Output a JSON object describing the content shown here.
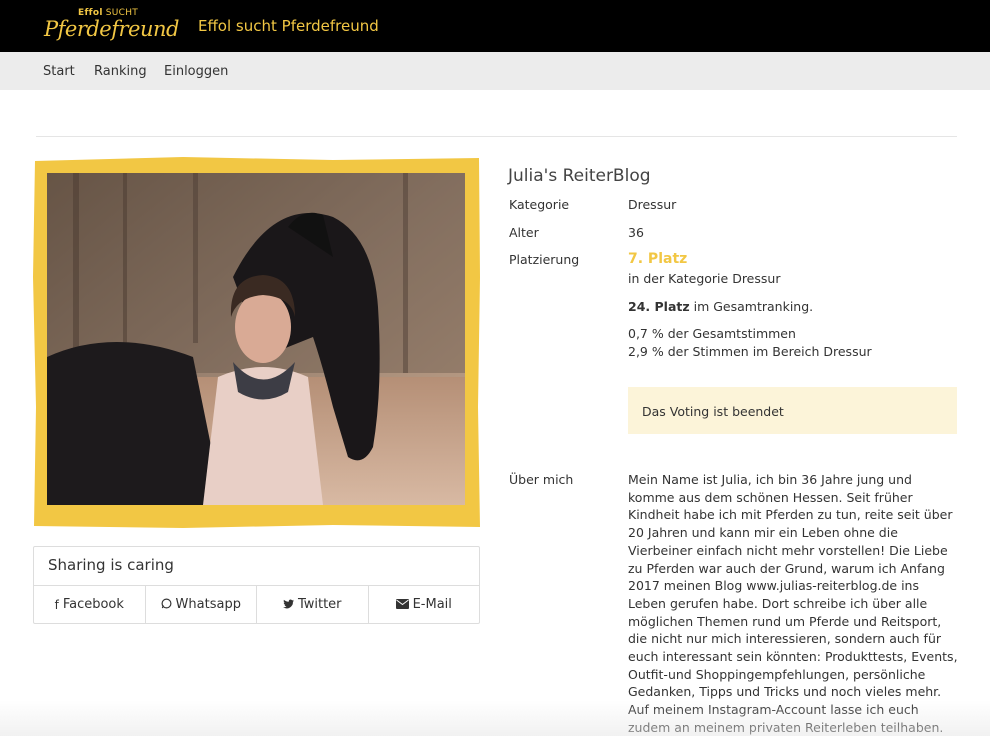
{
  "header": {
    "logo_small": "Effol",
    "logo_small_suffix": "SUCHT",
    "logo_big": "Pferdefreund",
    "site_title": "Effol sucht Pferdefreund",
    "accent_color": "#f2c744"
  },
  "nav": {
    "items": [
      {
        "label": "Start"
      },
      {
        "label": "Ranking"
      },
      {
        "label": "Einloggen"
      }
    ]
  },
  "sharing": {
    "title": "Sharing is caring",
    "buttons": [
      {
        "label": "Facebook",
        "icon": "facebook-icon"
      },
      {
        "label": "Whatsapp",
        "icon": "whatsapp-icon"
      },
      {
        "label": "Twitter",
        "icon": "twitter-icon"
      },
      {
        "label": "E-Mail",
        "icon": "envelope-icon"
      }
    ]
  },
  "profile": {
    "blog_name": "Julia's ReiterBlog",
    "category_label": "Kategorie",
    "category_value": "Dressur",
    "age_label": "Alter",
    "age_value": "36",
    "placement_label": "Platzierung",
    "rank": "7. Platz",
    "rank_sub": "in der Kategorie Dressur",
    "total_rank_num": "24. Platz",
    "total_rank_text": "im Gesamtranking.",
    "pct_total": "0,7 % der Gesamtstimmen",
    "pct_category": "2,9 % der Stimmen im Bereich Dressur",
    "vote_status": "Das Voting ist beendet",
    "about_label": "Über mich",
    "about_text": "Mein Name ist Julia, ich bin 36 Jahre jung und komme aus dem schönen Hessen. Seit früher Kindheit habe ich mit Pferden zu tun, reite seit über 20 Jahren und kann mir ein Leben ohne die Vierbeiner einfach nicht mehr vorstellen! Die Liebe zu Pferden war auch der Grund, warum ich Anfang 2017 meinen Blog www.julias-reiterblog.de ins Leben gerufen habe. Dort schreibe ich über alle möglichen Themen rund um Pferde und Reitsport, die nicht nur mich interessieren, sondern auch für euch interessant sein könnten: Produkttests, Events, Outfit-und Shoppingempfehlungen, persönliche Gedanken, Tipps und Tricks und noch vieles mehr. Auf meinem Instagram-Account lasse ich euch zudem an meinem privaten Reiterleben teilhaben. Und vor Kurzem habe"
  }
}
